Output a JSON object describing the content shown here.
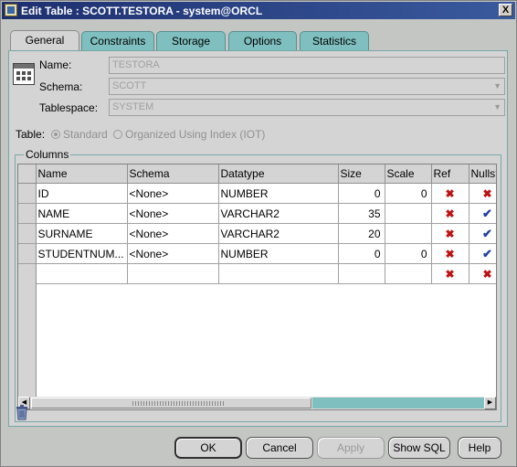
{
  "window": {
    "title": "Edit Table : SCOTT.TESTORA - system@ORCL",
    "close_glyph": "X"
  },
  "tabs": [
    {
      "label": "General",
      "active": true
    },
    {
      "label": "Constraints",
      "active": false
    },
    {
      "label": "Storage",
      "active": false
    },
    {
      "label": "Options",
      "active": false
    },
    {
      "label": "Statistics",
      "active": false
    }
  ],
  "general": {
    "name_label": "Name:",
    "name_value": "TESTORA",
    "schema_label": "Schema:",
    "schema_value": "SCOTT",
    "tablespace_label": "Tablespace:",
    "tablespace_value": "SYSTEM",
    "table_label": "Table:",
    "table_types": [
      {
        "label": "Standard",
        "selected": true
      },
      {
        "label": "Organized Using Index (IOT)",
        "selected": false
      }
    ]
  },
  "columns_group": {
    "title": "Columns",
    "headers": [
      "Name",
      "Schema",
      "Datatype",
      "Size",
      "Scale",
      "Ref",
      "Nulls?"
    ],
    "rows": [
      {
        "name": "ID",
        "schema": "<None>",
        "datatype": "NUMBER",
        "size": "0",
        "scale": "0",
        "ref": "x",
        "nulls": "x"
      },
      {
        "name": "NAME",
        "schema": "<None>",
        "datatype": "VARCHAR2",
        "size": "35",
        "scale": "",
        "ref": "x",
        "nulls": "check"
      },
      {
        "name": "SURNAME",
        "schema": "<None>",
        "datatype": "VARCHAR2",
        "size": "20",
        "scale": "",
        "ref": "x",
        "nulls": "check"
      },
      {
        "name": "STUDENTNUM...",
        "schema": "<None>",
        "datatype": "NUMBER",
        "size": "0",
        "scale": "0",
        "ref": "x",
        "nulls": "check"
      },
      {
        "name": "",
        "schema": "",
        "datatype": "",
        "size": "",
        "scale": "",
        "ref": "x",
        "nulls": "x"
      }
    ],
    "scroll_position": 0
  },
  "icons": {
    "title": "table-icon",
    "table": "table-grid-icon",
    "delete": "trash-icon",
    "ref_no": "red-x-icon",
    "nulls_yes": "blue-check-icon"
  },
  "colors": {
    "accent_tab": "#7fbfbf",
    "title_bar": "#1d2f6e",
    "cross": "#c01010",
    "check": "#1f3f9f"
  },
  "buttons": {
    "ok": "OK",
    "cancel": "Cancel",
    "apply": "Apply",
    "show_sql": "Show SQL",
    "help": "Help"
  }
}
